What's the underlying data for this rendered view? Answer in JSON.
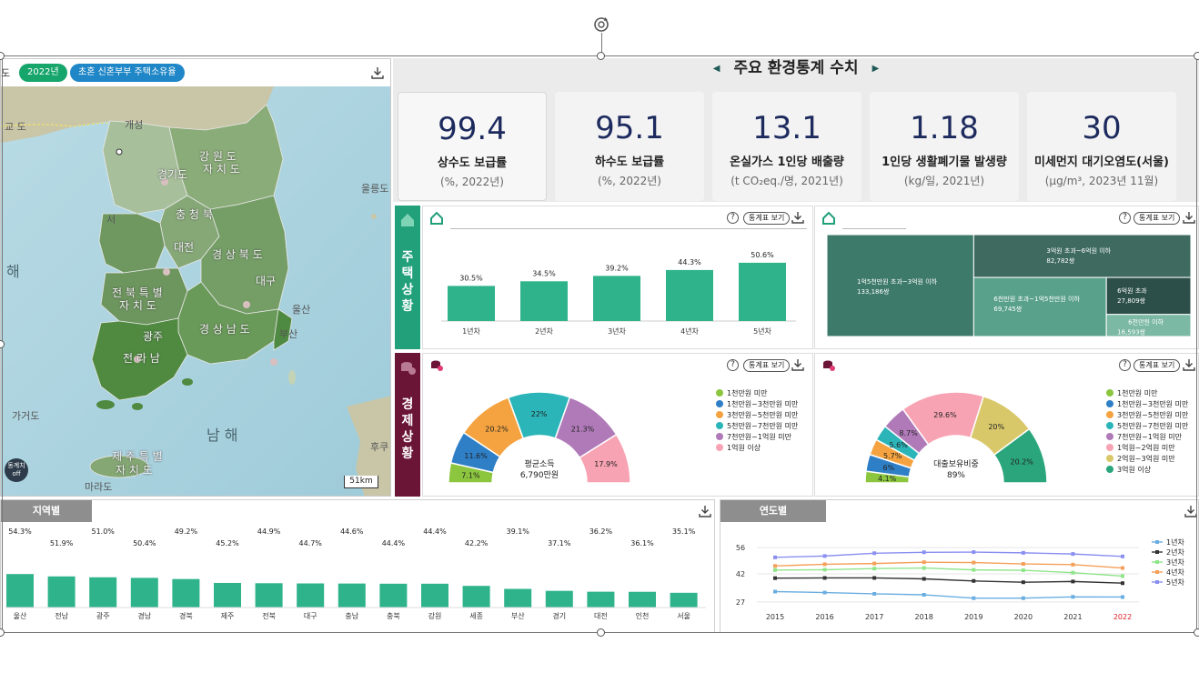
{
  "map": {
    "region_prefix": "도",
    "year_pill": "2022년",
    "topic_pill": "초혼 신혼부부 주택소유율",
    "labels": {
      "kaesong": "개성",
      "gangwon": "강 원 도",
      "gangwon2": "자 치 도",
      "gyeonggi": "경기도",
      "chungbuk": "충 청 북",
      "daejeon": "대전",
      "gyeongbuk": "경 상 북 도",
      "jeonbuk": "전 북 특 별",
      "jeonbuk2": "자 치 도",
      "gwangju": "광주",
      "jeonnam": "전 라 남",
      "gyeongnam": "경 상 남 도",
      "ulsan": "울산",
      "busan": "부산",
      "daegu": "대구",
      "jeju": "제 주 특 별",
      "jeju2": "자 치 도",
      "marado": "마라도",
      "gageodo": "가거도",
      "ulleungdo": "울릉도",
      "hae": "해",
      "seoul_sea": "서",
      "namhae": "남 해",
      "huku": "후쿠",
      "guyodo": "교 도"
    },
    "toggle_label": "동계치 off",
    "scale": "51km"
  },
  "header": {
    "title": "주요 환경통계 수치"
  },
  "stats": [
    {
      "value": "99.4",
      "name": "상수도 보급률",
      "unit": "(%, 2022년)"
    },
    {
      "value": "95.1",
      "name": "하수도 보급률",
      "unit": "(%, 2022년)"
    },
    {
      "value": "13.1",
      "name": "온실가스 1인당 배출량",
      "unit": "(t CO₂eq./명, 2021년)"
    },
    {
      "value": "1.18",
      "name": "1인당 생활폐기물 발생량",
      "unit": "(kg/일, 2021년)"
    },
    {
      "value": "30",
      "name": "미세먼지 대기오염도(서울)",
      "unit": "(μg/m³, 2023년 11월)"
    }
  ],
  "sections": {
    "housing": "주택상황",
    "economy": "경제상황"
  },
  "buttons": {
    "help": "?",
    "table": "통계표 보기"
  },
  "colors": {
    "accent_green": "#2fb38a",
    "treemap_dark": "#3e7a69",
    "econ_maroon": "#6b1536",
    "map_land": "#6d9a5a",
    "sea": "#a9d2de"
  },
  "chart_data": [
    {
      "type": "bar",
      "categories": [
        "1년차",
        "2년차",
        "3년차",
        "4년차",
        "5년차"
      ],
      "values": [
        30.5,
        34.5,
        39.2,
        44.3,
        50.6
      ],
      "value_labels": [
        "30.5%",
        "34.5%",
        "39.2%",
        "44.3%",
        "50.6%"
      ],
      "ylim": [
        0,
        60
      ]
    },
    {
      "type": "treemap",
      "items": [
        {
          "label": "1억5천만원 초과~3억원 이하",
          "value_label": "133,186쌍",
          "value": 133186,
          "color": "#3e7a69"
        },
        {
          "label": "3억원 초과~6억원 이하",
          "value_label": "82,782쌍",
          "value": 82782,
          "color": "#3e6a60"
        },
        {
          "label": "6천만원 초과~1억5천만원 이하",
          "value_label": "69,745쌍",
          "value": 69745,
          "color": "#5aa18b"
        },
        {
          "label": "6억원 초과",
          "value_label": "27,809쌍",
          "value": 27809,
          "color": "#2d4f4a"
        },
        {
          "label": "6천만원 이하",
          "value_label": "16,593쌍",
          "value": 16593,
          "color": "#7cb9a4"
        }
      ]
    },
    {
      "type": "pie",
      "subtype": "half-donut",
      "center_title": "평균소득",
      "center_value": "6,790만원",
      "slices": [
        {
          "name": "1천만원 미만",
          "value": 7.1,
          "label": "7.1%",
          "color": "#8cc63f"
        },
        {
          "name": "1천만원~3천만원 미만",
          "value": 11.6,
          "label": "11.6%",
          "color": "#2f7fc7"
        },
        {
          "name": "3천만원~5천만원 미만",
          "value": 20.2,
          "label": "20.2%",
          "color": "#f4a340"
        },
        {
          "name": "5천만원~7천만원 미만",
          "value": 22,
          "label": "22%",
          "color": "#2bb5b8"
        },
        {
          "name": "7천만원~1억원 미만",
          "value": 21.3,
          "label": "21.3%",
          "color": "#b07ab9"
        },
        {
          "name": "1억원 이상",
          "value": 17.9,
          "label": "17.9%",
          "color": "#f8a3b3"
        }
      ]
    },
    {
      "type": "pie",
      "subtype": "half-donut",
      "center_title": "대출보유비중",
      "center_value": "89%",
      "slices": [
        {
          "name": "1천만원 미만",
          "value": 4.1,
          "label": "4.1%",
          "color": "#8cc63f"
        },
        {
          "name": "1천만원~3천만원 미만",
          "value": 6,
          "label": "6%",
          "color": "#2f7fc7"
        },
        {
          "name": "3천만원~5천만원 미만",
          "value": 5.7,
          "label": "5.7%",
          "color": "#f4a340"
        },
        {
          "name": "5천만원~7천만원 미만",
          "value": 5.6,
          "label": "5.6%",
          "color": "#2bb5b8"
        },
        {
          "name": "7천만원~1억원 미만",
          "value": 8.7,
          "label": "8.7%",
          "color": "#b07ab9"
        },
        {
          "name": "1억원~2억원 미만",
          "value": 29.6,
          "label": "29.6%",
          "color": "#f8a3b3"
        },
        {
          "name": "2억원~3억원 미만",
          "value": 20,
          "label": "20%",
          "color": "#d9c86a"
        },
        {
          "name": "3억원 이상",
          "value": 20.2,
          "label": "20.2%",
          "color": "#2aa57c"
        }
      ]
    },
    {
      "type": "bar",
      "tab": "지역별",
      "categories": [
        "울산",
        "전남",
        "광주",
        "경남",
        "경북",
        "제주",
        "전북",
        "대구",
        "충남",
        "충북",
        "강원",
        "세종",
        "부산",
        "경기",
        "대전",
        "인천",
        "서울"
      ],
      "values": [
        54.3,
        51.9,
        51.0,
        50.4,
        49.2,
        45.2,
        44.9,
        44.7,
        44.6,
        44.4,
        44.4,
        42.2,
        39.1,
        37.1,
        36.2,
        36.1,
        35.1
      ],
      "value_labels": [
        "54.3%",
        "51.9%",
        "51.0%",
        "50.4%",
        "49.2%",
        "45.2%",
        "44.9%",
        "44.7%",
        "44.6%",
        "44.4%",
        "44.4%",
        "42.2%",
        "39.1%",
        "37.1%",
        "36.2%",
        "36.1%",
        "35.1%"
      ],
      "ylim": [
        0,
        60
      ]
    },
    {
      "type": "line",
      "tab": "연도별",
      "x": [
        "2015",
        "2016",
        "2017",
        "2018",
        "2019",
        "2020",
        "2021",
        "2022"
      ],
      "highlight_x": "2022",
      "yticks": [
        27,
        42,
        56
      ],
      "ylim": [
        24,
        58
      ],
      "grid": true,
      "legend_position": "right",
      "series": [
        {
          "name": "1년차",
          "color": "#6aaee0",
          "marker": "square",
          "values": [
            32.5,
            32,
            31.3,
            30.8,
            29,
            29,
            29.7,
            29.6
          ]
        },
        {
          "name": "2년차",
          "color": "#333333",
          "marker": "diamond",
          "values": [
            39.7,
            39.8,
            39.8,
            39.3,
            38.2,
            37.5,
            37.9,
            37
          ]
        },
        {
          "name": "3년차",
          "color": "#8fe58a",
          "marker": "square",
          "values": [
            44,
            44.2,
            44.8,
            45.1,
            44.1,
            43.9,
            42.6,
            40.8
          ]
        },
        {
          "name": "4년차",
          "color": "#f4a05a",
          "marker": "triangle",
          "values": [
            46.2,
            47.1,
            47.5,
            48.2,
            48,
            47.3,
            46.9,
            45.1
          ]
        },
        {
          "name": "5년차",
          "color": "#8a8ff0",
          "marker": "triangle-down",
          "values": [
            50.8,
            51.5,
            53,
            53.5,
            53.6,
            53.2,
            52.6,
            51.3
          ]
        }
      ]
    }
  ]
}
